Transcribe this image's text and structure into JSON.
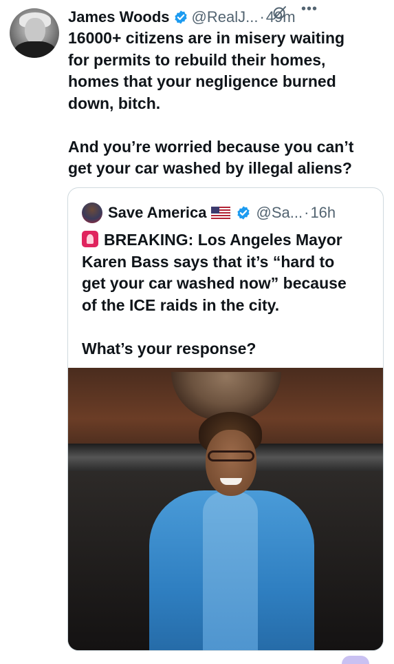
{
  "tweet": {
    "author_name": "James Woods",
    "handle": "@RealJ...",
    "separator": "·",
    "time": "49m",
    "text": "16000+ citizens are in misery waiting\nfor permits to rebuild their homes,\nhomes that your negligence burned\ndown, bitch.\n\nAnd you’re worried because you can’t\nget your car washed by illegal aliens?"
  },
  "quoted": {
    "author_name": "Save America",
    "handle": "@Sa...",
    "separator": "·",
    "time": "16h",
    "text": "BREAKING: Los Angeles Mayor\nKaren Bass says that it’s “hard to\nget your car washed now” because\nof the ICE raids in the city.\n\nWhat’s your response?"
  },
  "icons": {
    "verified": "verified-badge-icon",
    "grok": "grok-icon",
    "more": "more-icon",
    "flag": "us-flag-icon",
    "siren": "siren-icon"
  },
  "colors": {
    "text": "#0f1419",
    "secondary": "#536471",
    "verified": "#1d9bf0",
    "border": "#cfd9de"
  }
}
